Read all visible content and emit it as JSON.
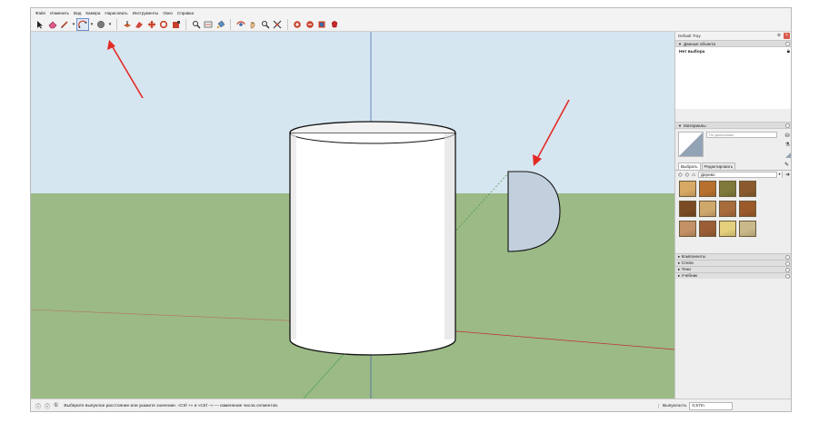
{
  "menu": [
    "Файл",
    "Изменить",
    "Вид",
    "Камера",
    "Нарисовать",
    "Инструменты",
    "Окно",
    "Справка"
  ],
  "toolbar": {
    "icons": [
      "select-arrow-icon",
      "eraser-icon",
      "pencil-line-icon",
      "circle-tool-icon",
      "polygon-icon",
      "pushpull-icon",
      "followme-icon",
      "move-icon",
      "rotate-icon",
      "scale-icon",
      "orbit-icon",
      "tape-measure-icon",
      "paint-bucket-icon",
      "section-icon",
      "pan-icon",
      "zoom-icon",
      "zoom-extents-icon",
      "warehouse-icon",
      "extension-icon",
      "layout-icon"
    ]
  },
  "tray": {
    "title": "Default Tray",
    "entity_info": {
      "header": "Данные объекта",
      "value": "Нет выбора"
    },
    "materials": {
      "header": "Материалы",
      "default_name": "По умолчанию",
      "tab_select": "Выбрать",
      "tab_edit": "Редактировать",
      "library": "Дерево",
      "swatches": [
        "#d8a865",
        "#b8702f",
        "#7d7a3a",
        "#8a5a2e",
        "#7a4b24",
        "#cfa86c",
        "#a86b3c",
        "#9b5a2a",
        "#c49065",
        "#9a5d36",
        "#e3cf7c",
        "#c9b889"
      ]
    },
    "collapsed": [
      "Компоненты",
      "Стили",
      "Тени",
      "Учебник"
    ]
  },
  "status": {
    "message": "Выберите выпуклое расстояние или укажите значение. «Ctrl +» и «Ctrl −» — изменение числа сегментов.",
    "measure_label": "Выпуклость",
    "measure_value": "0,57m"
  },
  "colors": {
    "sky": "#d6e6f1",
    "ground": "#9bba86",
    "arc_fill": "#c2d0de",
    "annotation": "#e22b25"
  }
}
